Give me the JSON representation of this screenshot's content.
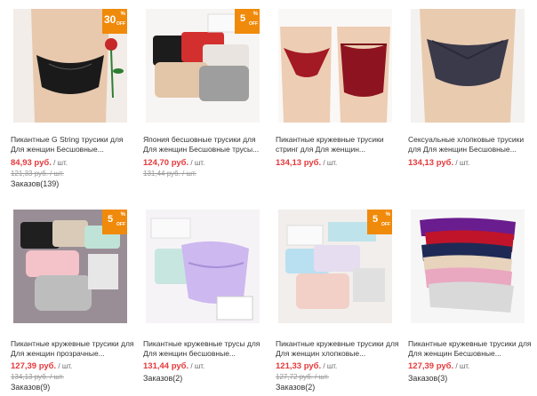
{
  "products": [
    {
      "title": "Пикантные G String трусики для Для женщин Бесшовные...",
      "price": "84,93 руб.",
      "unit": " / шт.",
      "old_price": "121,33 руб. / шт.",
      "orders": "Заказов(139)",
      "badge": {
        "num": "30",
        "pct": "%",
        "off": "OFF"
      }
    },
    {
      "title": "Япония бесшовные трусики для Для женщин Бесшовные трусы...",
      "price": "124,70 руб.",
      "unit": " / шт.",
      "old_price": "131,44 руб. / шт.",
      "orders": "",
      "badge": {
        "num": "5",
        "pct": "%",
        "off": "OFF"
      }
    },
    {
      "title": "Пикантные кружевные трусики стринг для Для женщин...",
      "price": "134,13 руб.",
      "unit": " / шт.",
      "old_price": "",
      "orders": "",
      "badge": null
    },
    {
      "title": "Сексуальные хлопковые трусики для Для женщин Бесшовные...",
      "price": "134,13 руб.",
      "unit": " / шт.",
      "old_price": "",
      "orders": "",
      "badge": null
    },
    {
      "title": "Пикантные кружевные трусики для Для женщин прозрачные...",
      "price": "127,39 руб.",
      "unit": " / шт.",
      "old_price": "134,13 руб. / шт.",
      "orders": "Заказов(9)",
      "badge": {
        "num": "5",
        "pct": "%",
        "off": "OFF"
      }
    },
    {
      "title": "Пикантные кружевные трусы для Для женщин бесшовные...",
      "price": "131,44 руб.",
      "unit": " / шт.",
      "old_price": "",
      "orders": "Заказов(2)",
      "badge": null
    },
    {
      "title": "Пикантные кружевные трусики для Для женщин хлопковые...",
      "price": "121,33 руб.",
      "unit": " / шт.",
      "old_price": "127,72 руб. / шт.",
      "orders": "Заказов(2)",
      "badge": {
        "num": "5",
        "pct": "%",
        "off": "OFF"
      }
    },
    {
      "title": "Пикантные кружевные трусики для Для женщин Бесшовные...",
      "price": "127,39 руб.",
      "unit": " / шт.",
      "old_price": "",
      "orders": "Заказов(3)",
      "badge": null
    }
  ],
  "colors": {
    "price": "#e4393c",
    "badge": "#f08a0a"
  }
}
